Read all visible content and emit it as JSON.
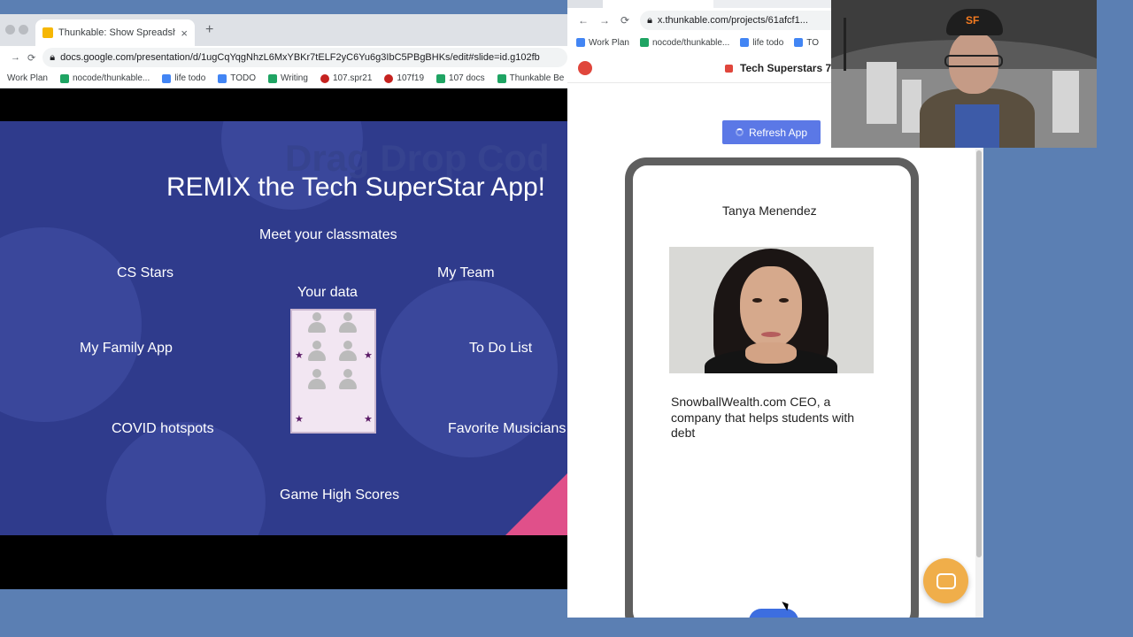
{
  "left_browser": {
    "tab_title": "Thunkable: Show Spreadsheet",
    "new_tab": "+",
    "url": "docs.google.com/presentation/d/1ugCqYqgNhzL6MxYBKr7tELF2yC6Yu6g3IbC5PBgBHKs/edit#slide=id.g102fb",
    "bookmarks": [
      "Work Plan",
      "nocode/thunkable...",
      "life todo",
      "TODO",
      "Writing",
      "107.spr21",
      "107f19",
      "107 docs",
      "Thunkable Be"
    ]
  },
  "slide": {
    "watermark": "Drag Drop Cod",
    "title": "REMIX the Tech SuperStar App!",
    "subtitle": "Meet your classmates",
    "center_label": "Your data",
    "items": {
      "cs_stars": "CS Stars",
      "my_team": "My Team",
      "my_family": "My Family App",
      "todo": "To Do List",
      "covid": "COVID hotspots",
      "musicians": "Favorite Musicians",
      "scores": "Game High Scores"
    }
  },
  "right_browser": {
    "url": "x.thunkable.com/projects/61afcf1...",
    "bookmarks": [
      "Work Plan",
      "nocode/thunkable...",
      "life todo",
      "TO"
    ],
    "app_title": "Tech Superstars 7",
    "refresh_label": "Refresh App"
  },
  "phone": {
    "student_name": "Tanya Menendez",
    "bio": "SnowballWealth.com CEO, a company that helps students with debt"
  },
  "colors": {
    "slide_bg": "#2f3b8c",
    "refresh_button": "#5b78e6",
    "chat_button": "#f0ae4a",
    "desktop_bg": "#5b7fb3"
  },
  "icons": [
    "back-icon",
    "forward-icon",
    "reload-icon",
    "lock-icon",
    "chat-icon",
    "star-icon"
  ]
}
